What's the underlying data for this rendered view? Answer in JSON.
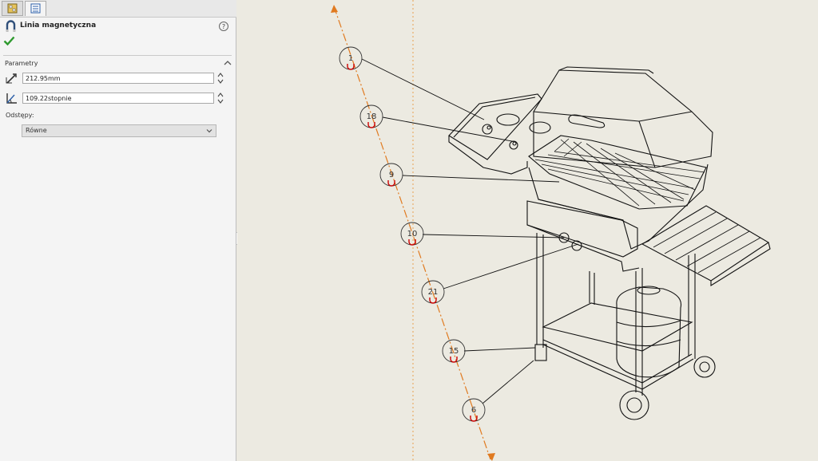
{
  "panel": {
    "tabs": [
      {
        "id": "feature-manager",
        "active": false
      },
      {
        "id": "property-manager",
        "active": true
      }
    ],
    "title": "Linia magnetyczna",
    "group_title": "Parametry",
    "length_value": "212.95mm",
    "angle_value": "109.22stopnie",
    "spacing_label": "Odstępy:",
    "spacing_selected": "Równe"
  },
  "canvas": {
    "balloons": [
      "1",
      "18",
      "9",
      "10",
      "21",
      "15",
      "6"
    ],
    "colors": {
      "background": "#eceae1",
      "guide": "#e07a20",
      "balloon_marker": "#cc0000"
    }
  }
}
